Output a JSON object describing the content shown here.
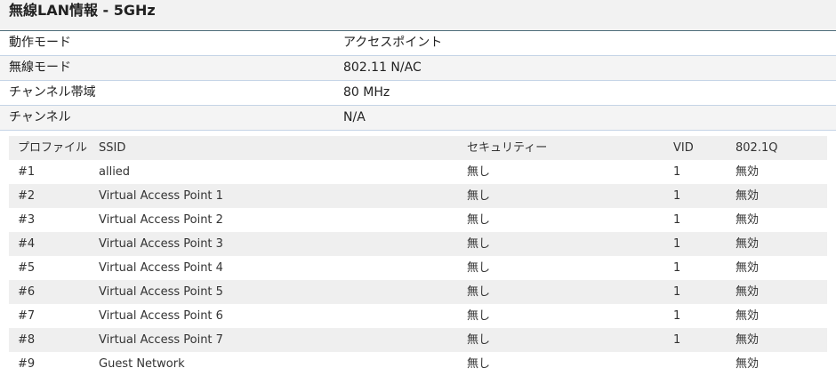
{
  "header": {
    "title": "無線LAN情報 - 5GHz"
  },
  "info": [
    {
      "label": "動作モード",
      "value": "アクセスポイント"
    },
    {
      "label": "無線モード",
      "value": "802.11 N/AC"
    },
    {
      "label": "チャンネル帯域",
      "value": "80 MHz"
    },
    {
      "label": "チャンネル",
      "value": "N/A"
    }
  ],
  "profiles": {
    "columns": [
      "プロファイル",
      "SSID",
      "セキュリティー",
      "VID",
      "802.1Q"
    ],
    "rows": [
      [
        "#1",
        "allied",
        "無し",
        "1",
        "無効"
      ],
      [
        "#2",
        "Virtual Access Point 1",
        "無し",
        "1",
        "無効"
      ],
      [
        "#3",
        "Virtual Access Point 2",
        "無し",
        "1",
        "無効"
      ],
      [
        "#4",
        "Virtual Access Point 3",
        "無し",
        "1",
        "無効"
      ],
      [
        "#5",
        "Virtual Access Point 4",
        "無し",
        "1",
        "無効"
      ],
      [
        "#6",
        "Virtual Access Point 5",
        "無し",
        "1",
        "無効"
      ],
      [
        "#7",
        "Virtual Access Point 6",
        "無し",
        "1",
        "無効"
      ],
      [
        "#8",
        "Virtual Access Point 7",
        "無し",
        "1",
        "無効"
      ],
      [
        "#9",
        "Guest Network",
        "無し",
        "",
        "無効"
      ]
    ]
  }
}
